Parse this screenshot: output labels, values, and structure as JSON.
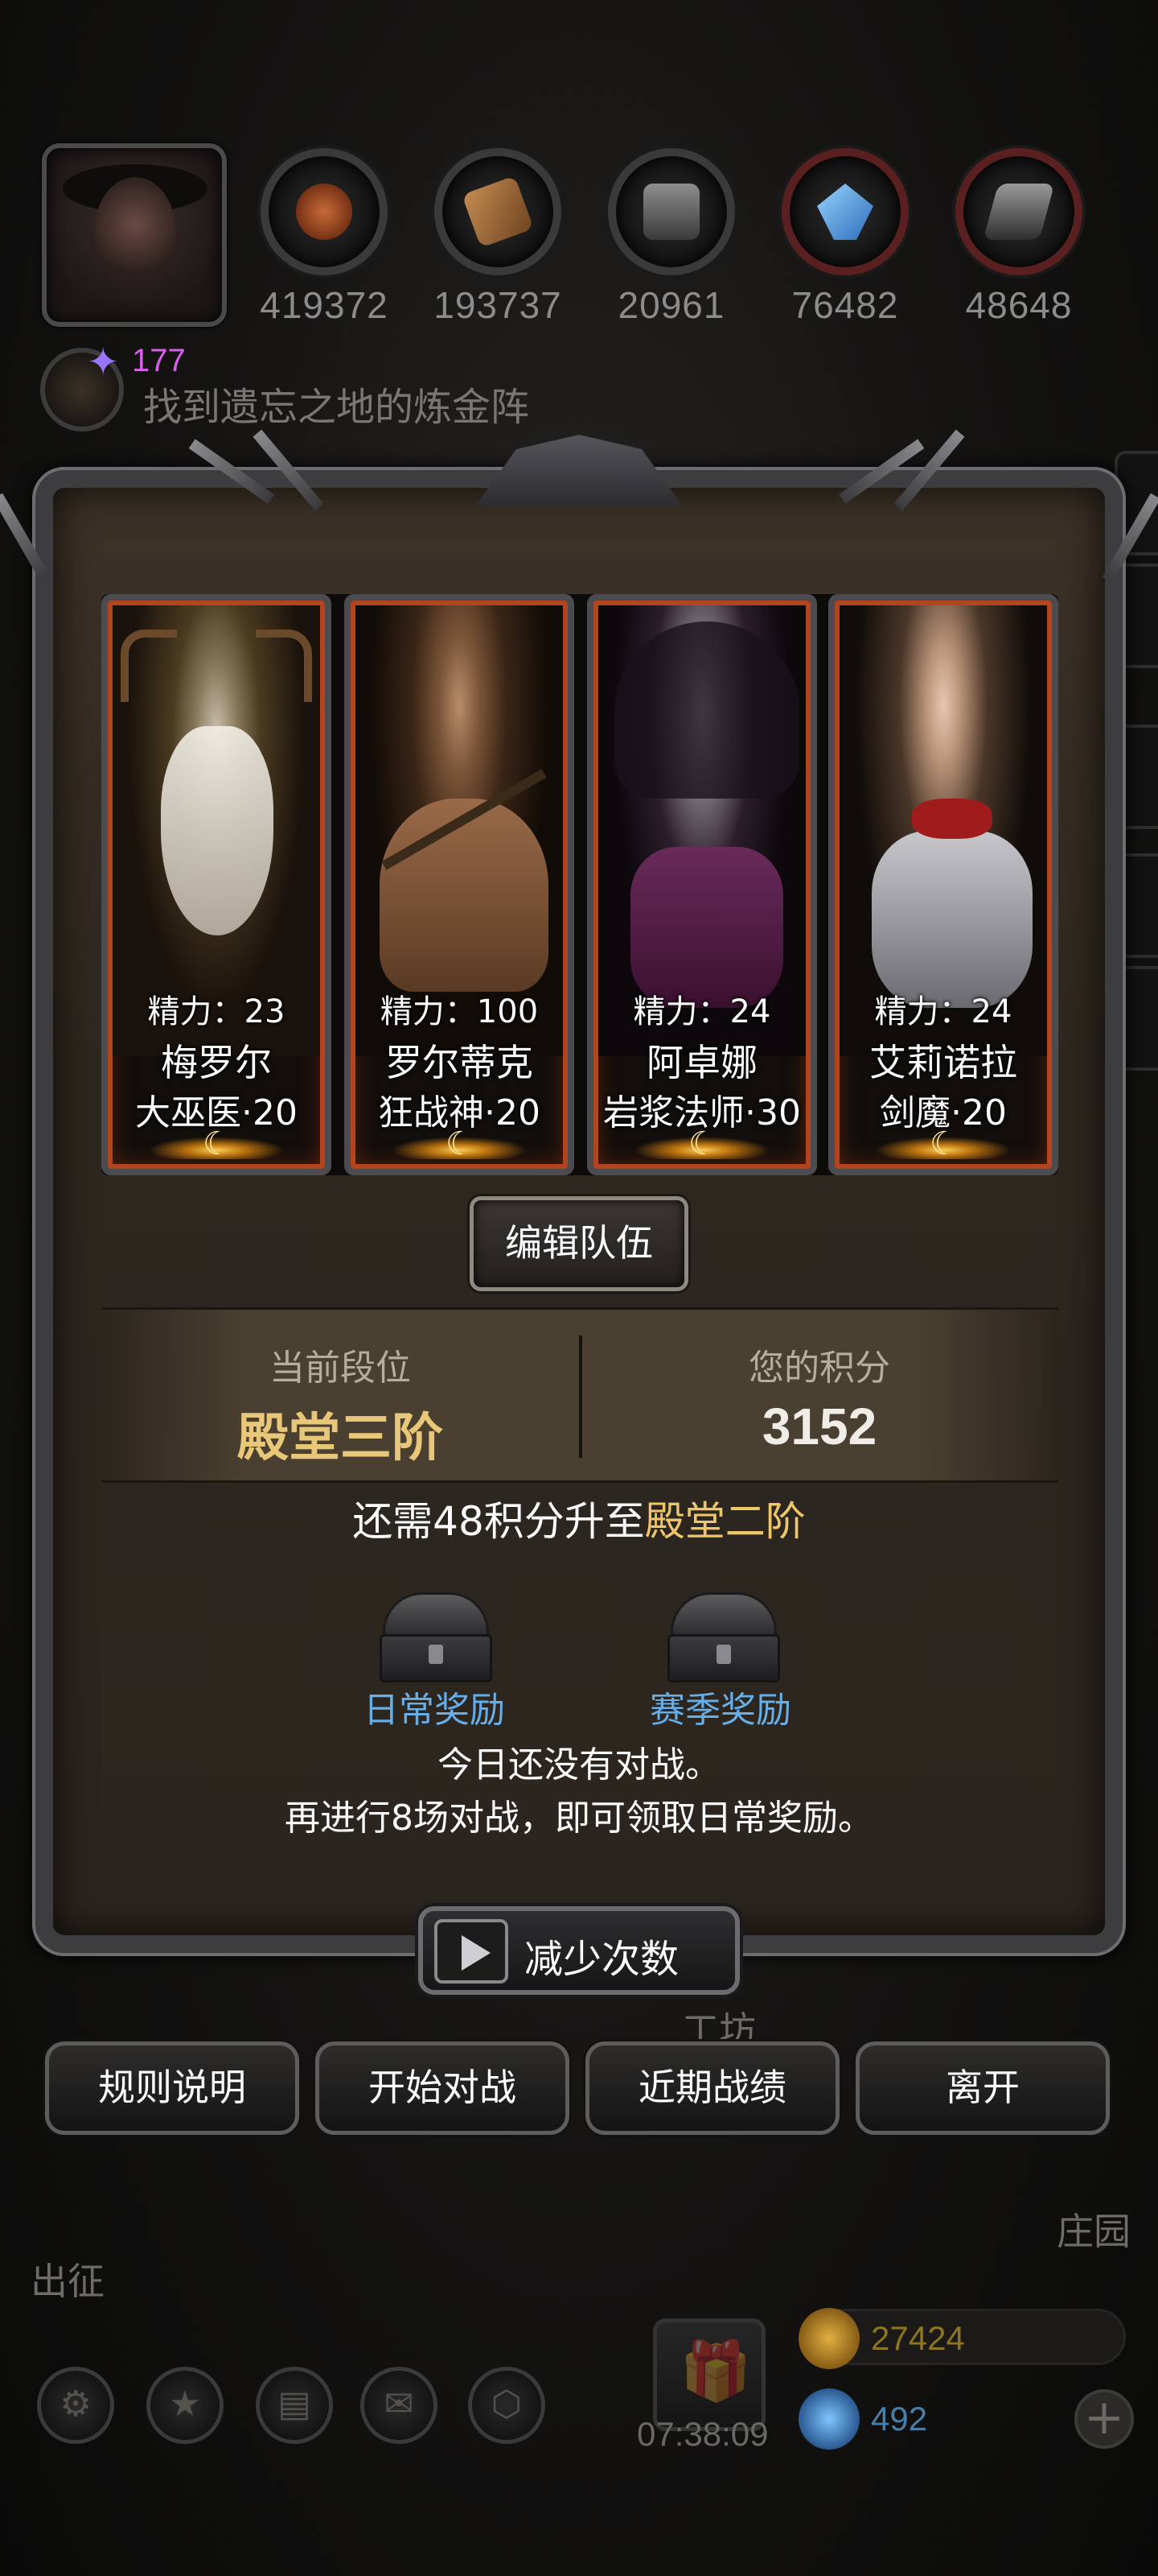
{
  "resources": [
    {
      "name": "meat-resource",
      "value": "419372",
      "color": "#b0542a"
    },
    {
      "name": "wood-resource",
      "value": "193737",
      "color": "#9a6a3c"
    },
    {
      "name": "stone-resource",
      "value": "20961",
      "color": "#7a7a7a"
    },
    {
      "name": "crystal-resource",
      "value": "76482",
      "color": "#4aa0e8"
    },
    {
      "name": "iron-resource",
      "value": "48648",
      "color": "#8a8a8a"
    }
  ],
  "quest": {
    "count": "177",
    "text": "找到遗忘之地的炼金阵"
  },
  "heroes": [
    {
      "stamina": "精力：23",
      "name": "梅罗尔",
      "class": "大巫医·20"
    },
    {
      "stamina": "精力：100",
      "name": "罗尔蒂克",
      "class": "狂战神·20"
    },
    {
      "stamina": "精力：24",
      "name": "阿卓娜",
      "class": "岩浆法师·30"
    },
    {
      "stamina": "精力：24",
      "name": "艾莉诺拉",
      "class": "剑魔·20"
    }
  ],
  "edit_team_label": "编辑队伍",
  "rank": {
    "current_label": "当前段位",
    "current_value": "殿堂三阶",
    "score_label": "您的积分",
    "score_value": "3152"
  },
  "promotion": {
    "prefix": "还需48积分升至",
    "target": "殿堂二阶"
  },
  "rewards": {
    "daily_label": "日常奖励",
    "season_label": "赛季奖励"
  },
  "info": {
    "line1": "今日还没有对战。",
    "line2": "再进行8场对战，即可领取日常奖励。"
  },
  "reduce_label": "减少次数",
  "actions": {
    "rules": "规则说明",
    "start": "开始对战",
    "records": "近期战绩",
    "leave": "离开"
  },
  "background": {
    "workshop": "工坊",
    "manor": "庄园",
    "expedition": "出征",
    "timer": "07:38:09",
    "gold": "27424",
    "gems": "492"
  },
  "colors": {
    "accent_gold": "#e8c779",
    "reward_blue": "#66aee8",
    "quest_purple": "#d660e8",
    "card_border": "#b3451e"
  }
}
